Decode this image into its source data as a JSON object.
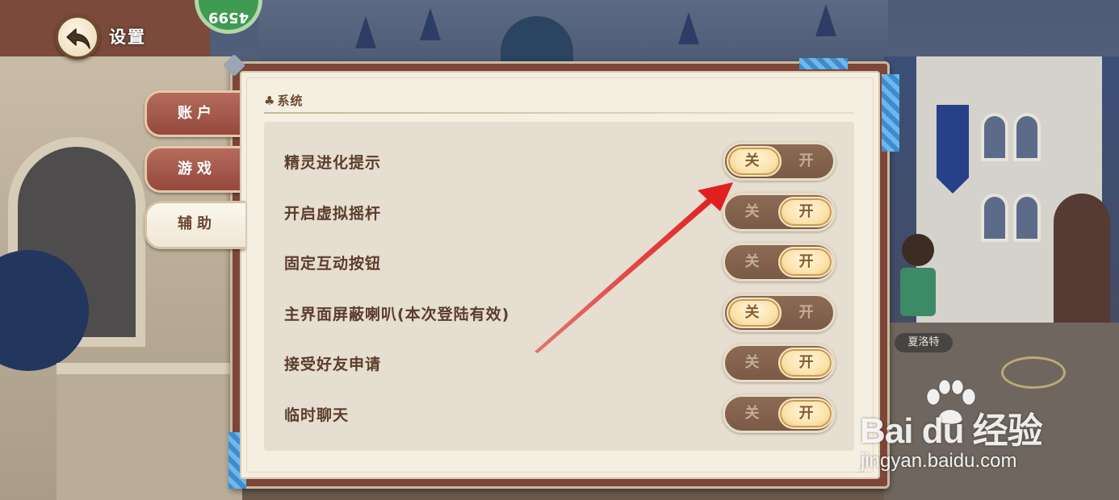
{
  "header": {
    "title": "设置",
    "back_icon": "back-arrow-icon",
    "badge_text": "4599"
  },
  "tabs": [
    {
      "label": "账户",
      "active": false
    },
    {
      "label": "游戏",
      "active": false
    },
    {
      "label": "辅助",
      "active": true
    }
  ],
  "section": {
    "title": "系统",
    "icon": "clover-icon"
  },
  "settings": [
    {
      "label": "精灵进化提示",
      "off_label": "关",
      "on_label": "开",
      "state": "off"
    },
    {
      "label": "开启虚拟摇杆",
      "off_label": "关",
      "on_label": "开",
      "state": "on"
    },
    {
      "label": "固定互动按钮",
      "off_label": "关",
      "on_label": "开",
      "state": "on"
    },
    {
      "label": "主界面屏蔽喇叭(本次登陆有效)",
      "off_label": "关",
      "on_label": "开",
      "state": "off"
    },
    {
      "label": "接受好友申请",
      "off_label": "关",
      "on_label": "开",
      "state": "on"
    },
    {
      "label": "临时聊天",
      "off_label": "关",
      "on_label": "开",
      "state": "on"
    }
  ],
  "npc_name": "夏洛特",
  "watermark": {
    "logo": "Bai du 经验",
    "url": "jingyan.baidu.com"
  },
  "colors": {
    "annotation_arrow": "#e02020",
    "tab_inactive": "#a35a4c",
    "knob_gold": "#fbe2a8",
    "label_brown": "#5b3d2c"
  }
}
